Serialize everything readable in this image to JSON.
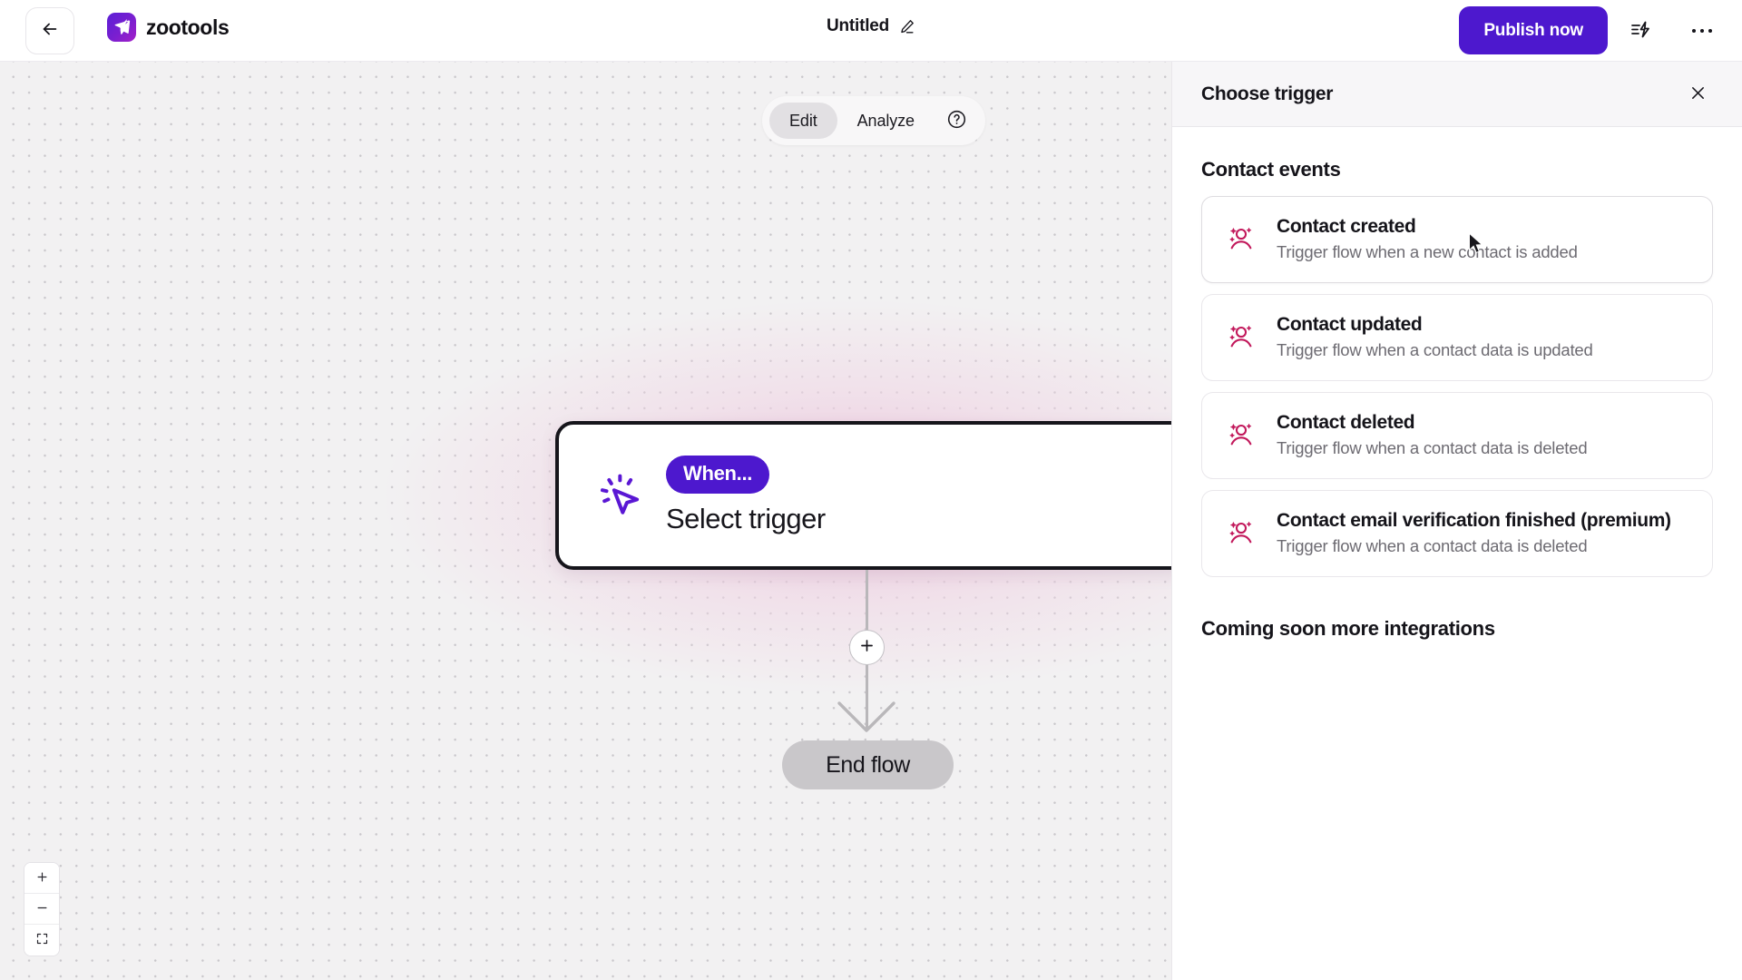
{
  "topbar": {
    "back_icon": "arrow-left-icon",
    "brand_name": "zootools",
    "brand_icon": "paper-plane-logo",
    "doc_title": "Untitled",
    "edit_title_icon": "pencil-icon",
    "publish_label": "Publish now",
    "flash_icon": "flash-lines-icon",
    "more_icon": "ellipsis-icon",
    "accent_color": "#4d18ce"
  },
  "canvas": {
    "mode_toggle": {
      "options": [
        "Edit",
        "Analyze"
      ],
      "selected": "Edit",
      "help_icon": "question-circle-icon"
    },
    "trigger_node": {
      "icon": "click-cursor-icon",
      "badge": "When...",
      "label": "Select trigger",
      "badge_color": "#4d18ce",
      "border_color": "#16151b"
    },
    "add_step_icon": "plus-icon",
    "end_node_label": "End flow",
    "zoom_controls": {
      "zoom_in": "plus-icon",
      "zoom_out": "minus-icon",
      "fit_view": "fit-screen-icon"
    }
  },
  "panel": {
    "title": "Choose trigger",
    "close_icon": "close-icon",
    "section_title": "Contact events",
    "triggers": [
      {
        "icon": "contact-sparkle-icon",
        "title": "Contact created",
        "description": "Trigger flow when a new contact is added",
        "selected": true
      },
      {
        "icon": "contact-sparkle-icon",
        "title": "Contact updated",
        "description": "Trigger flow when a contact data is updated",
        "selected": false
      },
      {
        "icon": "contact-sparkle-icon",
        "title": "Contact deleted",
        "description": "Trigger flow when a contact data is deleted",
        "selected": false
      },
      {
        "icon": "contact-sparkle-icon",
        "title": "Contact email verification finished (premium)",
        "description": "Trigger flow when a contact data is deleted",
        "selected": false
      }
    ],
    "coming_soon": "Coming soon more integrations",
    "icon_color": "#c2185b"
  }
}
